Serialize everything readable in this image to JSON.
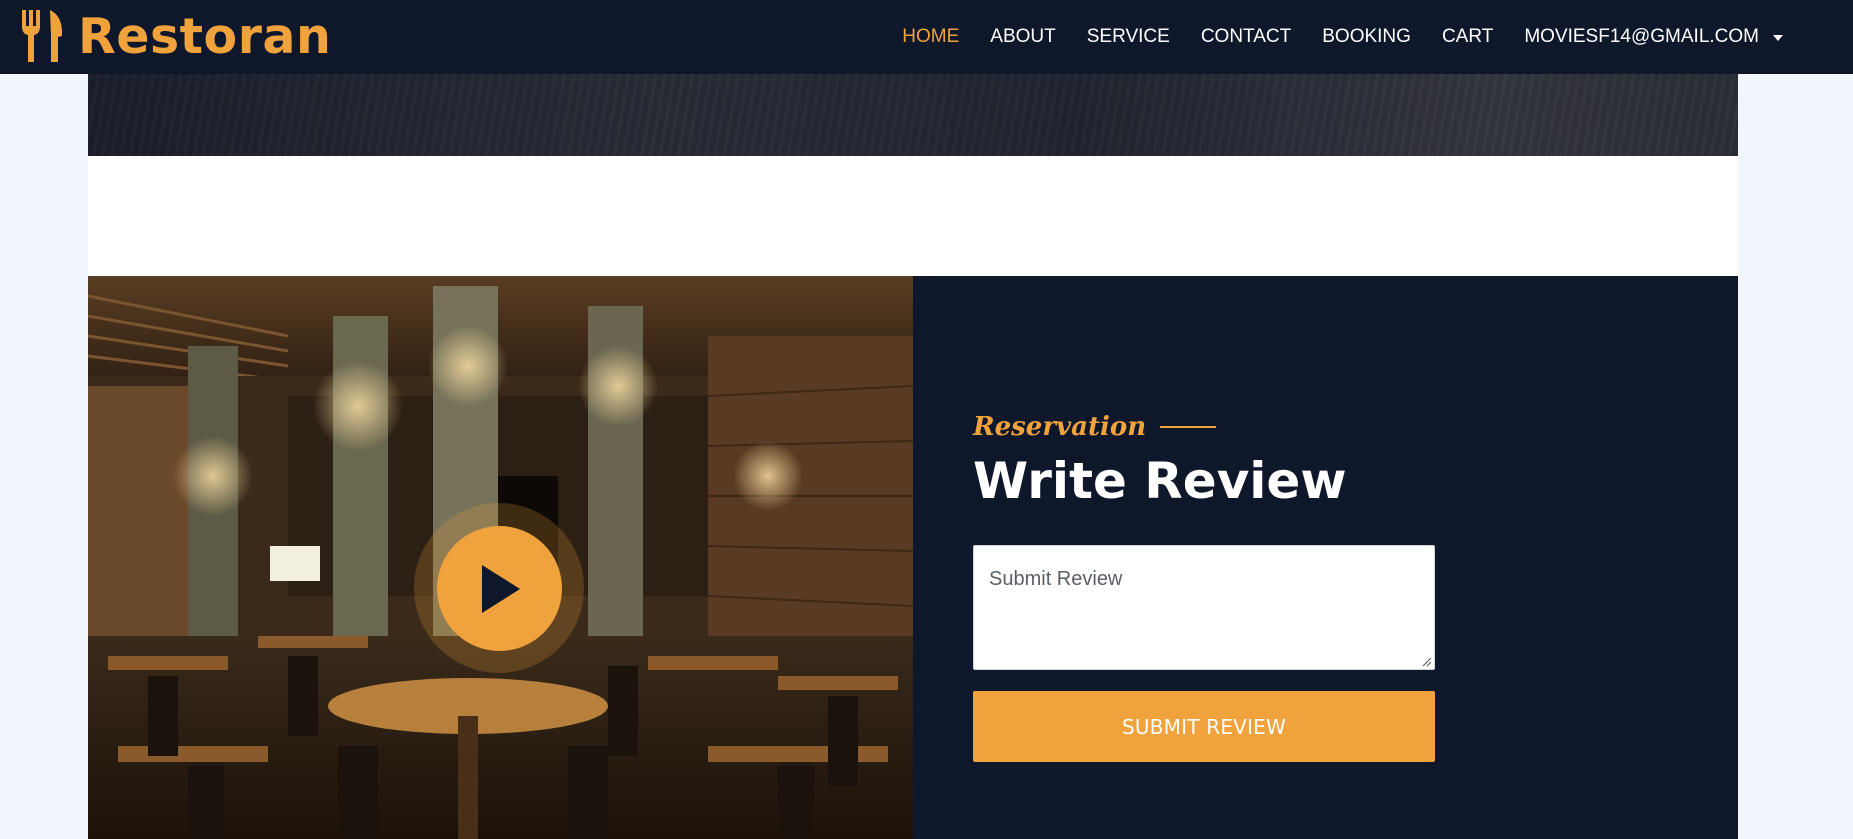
{
  "brand": {
    "name": "Restoran",
    "icon": "utensils-icon"
  },
  "nav": {
    "items": [
      {
        "label": "HOME",
        "active": true
      },
      {
        "label": "ABOUT",
        "active": false
      },
      {
        "label": "SERVICE",
        "active": false
      },
      {
        "label": "CONTACT",
        "active": false
      },
      {
        "label": "BOOKING",
        "active": false
      },
      {
        "label": "CART",
        "active": false
      }
    ],
    "account": {
      "label": "MOVIESF14@GMAIL.COM",
      "icon": "caret-down-icon"
    }
  },
  "video": {
    "icon": "play-icon"
  },
  "review": {
    "subtitle": "Reservation",
    "title": "Write Review",
    "input_placeholder": "Submit Review",
    "input_value": "",
    "submit_label": "SUBMIT REVIEW"
  },
  "colors": {
    "primary": "#f0a33c",
    "dark": "#0f172b",
    "page_bg": "#f1f6fd",
    "white": "#ffffff"
  }
}
